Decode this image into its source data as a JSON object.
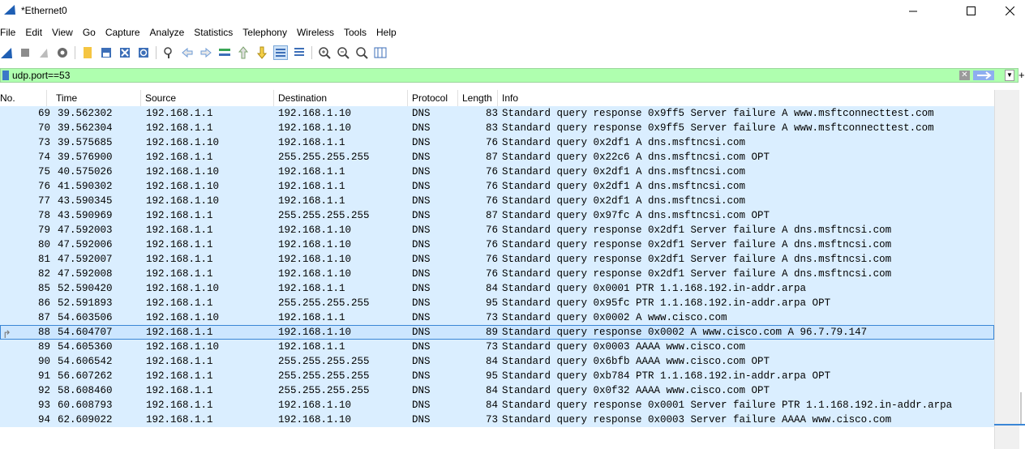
{
  "window": {
    "title": "*Ethernet0"
  },
  "menu": [
    "File",
    "Edit",
    "View",
    "Go",
    "Capture",
    "Analyze",
    "Statistics",
    "Telephony",
    "Wireless",
    "Tools",
    "Help"
  ],
  "filter": {
    "value": "udp.port==53"
  },
  "columns": {
    "no": "No.",
    "time": "Time",
    "source": "Source",
    "destination": "Destination",
    "protocol": "Protocol",
    "length": "Length",
    "info": "Info"
  },
  "packets": [
    {
      "no": "69",
      "time": "39.562302",
      "src": "192.168.1.1",
      "dst": "192.168.1.10",
      "proto": "DNS",
      "len": "83",
      "info": "Standard query response 0x9ff5 Server failure A www.msftconnecttest.com"
    },
    {
      "no": "70",
      "time": "39.562304",
      "src": "192.168.1.1",
      "dst": "192.168.1.10",
      "proto": "DNS",
      "len": "83",
      "info": "Standard query response 0x9ff5 Server failure A www.msftconnecttest.com"
    },
    {
      "no": "73",
      "time": "39.575685",
      "src": "192.168.1.10",
      "dst": "192.168.1.1",
      "proto": "DNS",
      "len": "76",
      "info": "Standard query 0x2df1 A dns.msftncsi.com"
    },
    {
      "no": "74",
      "time": "39.576900",
      "src": "192.168.1.1",
      "dst": "255.255.255.255",
      "proto": "DNS",
      "len": "87",
      "info": "Standard query 0x22c6 A dns.msftncsi.com OPT"
    },
    {
      "no": "75",
      "time": "40.575026",
      "src": "192.168.1.10",
      "dst": "192.168.1.1",
      "proto": "DNS",
      "len": "76",
      "info": "Standard query 0x2df1 A dns.msftncsi.com"
    },
    {
      "no": "76",
      "time": "41.590302",
      "src": "192.168.1.10",
      "dst": "192.168.1.1",
      "proto": "DNS",
      "len": "76",
      "info": "Standard query 0x2df1 A dns.msftncsi.com"
    },
    {
      "no": "77",
      "time": "43.590345",
      "src": "192.168.1.10",
      "dst": "192.168.1.1",
      "proto": "DNS",
      "len": "76",
      "info": "Standard query 0x2df1 A dns.msftncsi.com"
    },
    {
      "no": "78",
      "time": "43.590969",
      "src": "192.168.1.1",
      "dst": "255.255.255.255",
      "proto": "DNS",
      "len": "87",
      "info": "Standard query 0x97fc A dns.msftncsi.com OPT"
    },
    {
      "no": "79",
      "time": "47.592003",
      "src": "192.168.1.1",
      "dst": "192.168.1.10",
      "proto": "DNS",
      "len": "76",
      "info": "Standard query response 0x2df1 Server failure A dns.msftncsi.com"
    },
    {
      "no": "80",
      "time": "47.592006",
      "src": "192.168.1.1",
      "dst": "192.168.1.10",
      "proto": "DNS",
      "len": "76",
      "info": "Standard query response 0x2df1 Server failure A dns.msftncsi.com"
    },
    {
      "no": "81",
      "time": "47.592007",
      "src": "192.168.1.1",
      "dst": "192.168.1.10",
      "proto": "DNS",
      "len": "76",
      "info": "Standard query response 0x2df1 Server failure A dns.msftncsi.com"
    },
    {
      "no": "82",
      "time": "47.592008",
      "src": "192.168.1.1",
      "dst": "192.168.1.10",
      "proto": "DNS",
      "len": "76",
      "info": "Standard query response 0x2df1 Server failure A dns.msftncsi.com"
    },
    {
      "no": "85",
      "time": "52.590420",
      "src": "192.168.1.10",
      "dst": "192.168.1.1",
      "proto": "DNS",
      "len": "84",
      "info": "Standard query 0x0001 PTR 1.1.168.192.in-addr.arpa"
    },
    {
      "no": "86",
      "time": "52.591893",
      "src": "192.168.1.1",
      "dst": "255.255.255.255",
      "proto": "DNS",
      "len": "95",
      "info": "Standard query 0x95fc PTR 1.1.168.192.in-addr.arpa OPT"
    },
    {
      "no": "87",
      "time": "54.603506",
      "src": "192.168.1.10",
      "dst": "192.168.1.1",
      "proto": "DNS",
      "len": "73",
      "info": "Standard query 0x0002 A www.cisco.com"
    },
    {
      "no": "88",
      "time": "54.604707",
      "src": "192.168.1.1",
      "dst": "192.168.1.10",
      "proto": "DNS",
      "len": "89",
      "info": "Standard query response 0x0002 A www.cisco.com A 96.7.79.147",
      "selected": true
    },
    {
      "no": "89",
      "time": "54.605360",
      "src": "192.168.1.10",
      "dst": "192.168.1.1",
      "proto": "DNS",
      "len": "73",
      "info": "Standard query 0x0003 AAAA www.cisco.com"
    },
    {
      "no": "90",
      "time": "54.606542",
      "src": "192.168.1.1",
      "dst": "255.255.255.255",
      "proto": "DNS",
      "len": "84",
      "info": "Standard query 0x6bfb AAAA www.cisco.com OPT"
    },
    {
      "no": "91",
      "time": "56.607262",
      "src": "192.168.1.1",
      "dst": "255.255.255.255",
      "proto": "DNS",
      "len": "95",
      "info": "Standard query 0xb784 PTR 1.1.168.192.in-addr.arpa OPT"
    },
    {
      "no": "92",
      "time": "58.608460",
      "src": "192.168.1.1",
      "dst": "255.255.255.255",
      "proto": "DNS",
      "len": "84",
      "info": "Standard query 0x0f32 AAAA www.cisco.com OPT"
    },
    {
      "no": "93",
      "time": "60.608793",
      "src": "192.168.1.1",
      "dst": "192.168.1.10",
      "proto": "DNS",
      "len": "84",
      "info": "Standard query response 0x0001 Server failure PTR 1.1.168.192.in-addr.arpa"
    },
    {
      "no": "94",
      "time": "62.609022",
      "src": "192.168.1.1",
      "dst": "192.168.1.10",
      "proto": "DNS",
      "len": "73",
      "info": "Standard query response 0x0003 Server failure AAAA www.cisco.com"
    }
  ],
  "colors": {
    "row_bg": "#daeeff",
    "filter_bg": "#afffaf",
    "accent": "#3a86d6"
  },
  "toolbar_icons": [
    "shark-fin-icon",
    "stop-icon",
    "restart-icon",
    "options-icon",
    "open-file-icon",
    "save-file-icon",
    "close-file-icon",
    "reload-icon",
    "find-icon",
    "back-icon",
    "forward-icon",
    "go-to-packet-icon",
    "first-packet-icon",
    "last-packet-icon",
    "autoscroll-icon",
    "colorize-icon",
    "zoom-in-icon",
    "zoom-out-icon",
    "zoom-reset-icon",
    "resize-columns-icon"
  ]
}
